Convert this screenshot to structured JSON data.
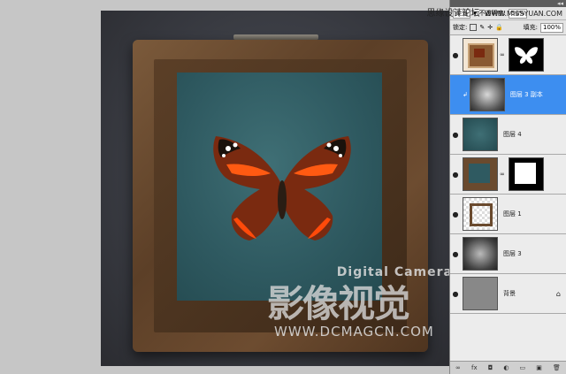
{
  "header": {
    "site_cn": "思缘设计论坛",
    "site_url": "WWW.MISSYUAN.COM"
  },
  "layers_panel": {
    "blend_mode": "柔光",
    "opacity_label": "不透明度:",
    "opacity_value": "50%",
    "lock_label": "锁定:",
    "fill_label": "填充:",
    "fill_value": "100%",
    "layers": [
      {
        "name": "",
        "has_mask": true,
        "thumb": "butterfly",
        "mask": "butterfly-mask",
        "selected": false
      },
      {
        "name": "图层 3 副本",
        "has_mask": false,
        "thumb": "dark-vignette",
        "selected": true
      },
      {
        "name": "图层 4",
        "has_mask": false,
        "thumb": "teal",
        "selected": false
      },
      {
        "name": "",
        "has_mask": true,
        "thumb": "frame",
        "mask": "frame-mask",
        "selected": false
      },
      {
        "name": "图层 1",
        "has_mask": false,
        "thumb": "frame-outline",
        "selected": false
      },
      {
        "name": "图层 3",
        "has_mask": false,
        "thumb": "dark-vignette",
        "selected": false
      },
      {
        "name": "背景",
        "has_mask": false,
        "thumb": "gray",
        "selected": false
      }
    ]
  },
  "watermark": {
    "top": "Digital Camera",
    "big": "影像视觉",
    "url": "WWW.DCMAGCN.COM"
  }
}
